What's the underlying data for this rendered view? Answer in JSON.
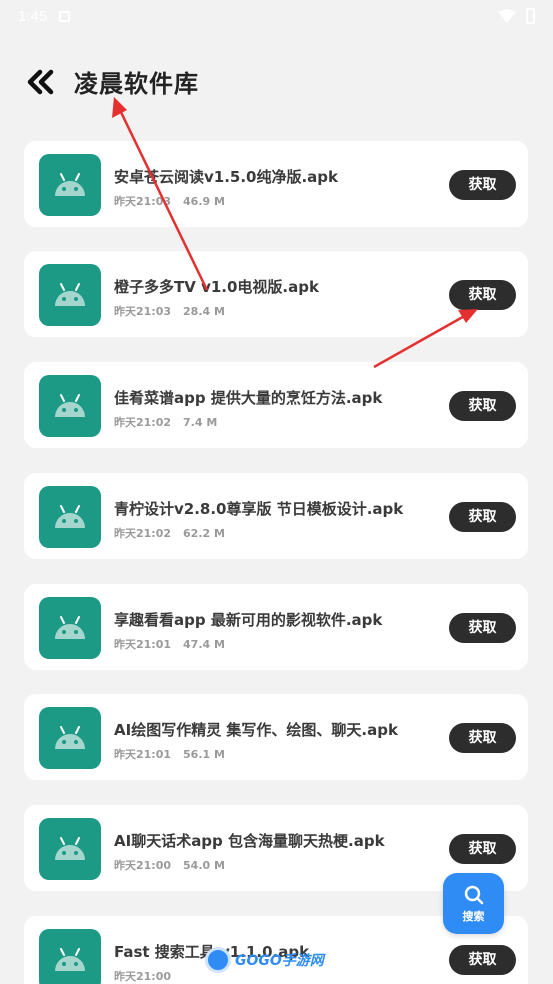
{
  "status_bar": {
    "time": "1:45"
  },
  "header": {
    "title": "凌晨软件库"
  },
  "files": [
    {
      "name": "安卓苍云阅读v1.5.0纯净版.apk",
      "time": "昨天21:03",
      "size": "46.9 M",
      "button": "获取"
    },
    {
      "name": "橙子多多TV v1.0电视版.apk",
      "time": "昨天21:03",
      "size": "28.4 M",
      "button": "获取"
    },
    {
      "name": "佳肴菜谱app 提供大量的烹饪方法.apk",
      "time": "昨天21:02",
      "size": "7.4 M",
      "button": "获取"
    },
    {
      "name": "青柠设计v2.8.0尊享版 节日模板设计.apk",
      "time": "昨天21:02",
      "size": "62.2 M",
      "button": "获取"
    },
    {
      "name": "享趣看看app 最新可用的影视软件.apk",
      "time": "昨天21:01",
      "size": "47.4 M",
      "button": "获取"
    },
    {
      "name": "AI绘图写作精灵 集写作、绘图、聊天.apk",
      "time": "昨天21:01",
      "size": "56.1 M",
      "button": "获取"
    },
    {
      "name": "AI聊天话术app 包含海量聊天热梗.apk",
      "time": "昨天21:00",
      "size": "54.0 M",
      "button": "获取"
    },
    {
      "name": "Fast 搜索工具 v1.1.0.apk",
      "time": "昨天21:00",
      "size": "",
      "button": "获取"
    }
  ],
  "search_fab": {
    "label": "搜索",
    "icon": "search-icon"
  },
  "watermark": {
    "text": "GOGO手游网"
  },
  "colors": {
    "accent": "#2f8cf5",
    "app_icon_bg": "#1d9a86",
    "button_bg": "#2d2d2d",
    "annotation_arrow": "#e53030"
  }
}
